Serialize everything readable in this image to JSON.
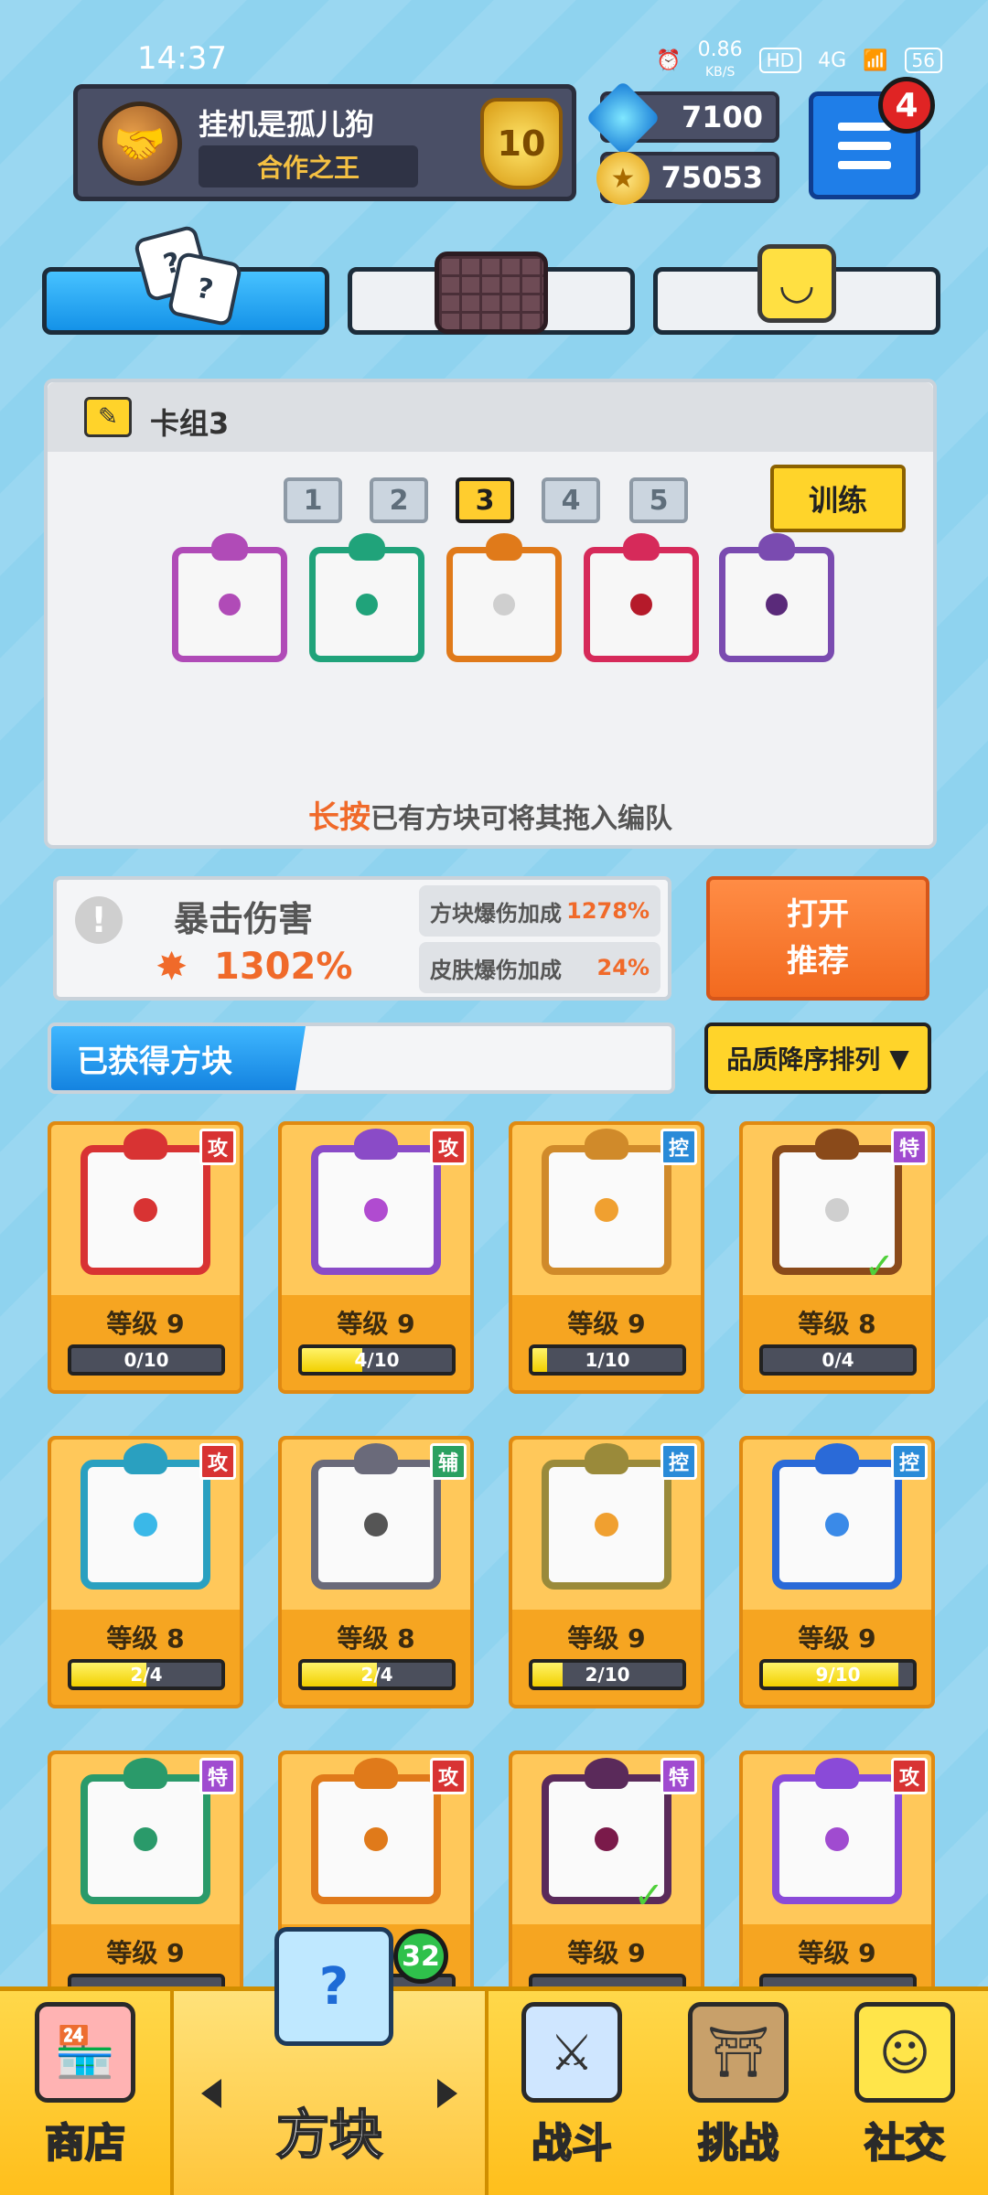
{
  "status_bar": {
    "time": "14:37",
    "net_speed": "0.86",
    "net_unit": "KB/S",
    "hd": "HD",
    "network": "4G",
    "battery": "56"
  },
  "profile": {
    "name": "挂机是孤儿狗",
    "title": "合作之王",
    "rank": "10"
  },
  "currency": {
    "gems": "7100",
    "coins": "75053"
  },
  "menu": {
    "badge": "4"
  },
  "deck": {
    "title": "卡组3",
    "numbers": [
      "1",
      "2",
      "3",
      "4",
      "5"
    ],
    "active_index": 2,
    "train_label": "训练",
    "slots": [
      {
        "border": "#b04bb7",
        "dot": "#b04bb7"
      },
      {
        "border": "#20a37a",
        "dot": "#20a37a"
      },
      {
        "border": "#e07a1a",
        "dot": "#cfcfcf"
      },
      {
        "border": "#d62a5a",
        "dot": "#b51a2a"
      },
      {
        "border": "#7a4bb0",
        "dot": "#5a2a7a"
      }
    ],
    "hint_highlight": "长按",
    "hint_text": "已有方块可将其拖入编队"
  },
  "crit": {
    "title": "暴击伤害",
    "value": "1302%",
    "stats": [
      {
        "label": "方块爆伤加成",
        "value": "1278%"
      },
      {
        "label": "皮肤爆伤加成",
        "value": "24%"
      }
    ]
  },
  "recommend": {
    "line1": "打开",
    "line2": "推荐"
  },
  "obtained": {
    "label": "已获得方块",
    "sort_label": "品质降序排列",
    "sort_icon": "▼"
  },
  "cards": [
    {
      "tag": "攻",
      "tag_color": "#d83333",
      "border": "#d83333",
      "dot": "#d83333",
      "level": "等级 9",
      "progress": "0/10",
      "fill": 0,
      "check": false
    },
    {
      "tag": "攻",
      "tag_color": "#d83333",
      "border": "#8a4bc7",
      "dot": "#b04bd0",
      "level": "等级 9",
      "progress": "4/10",
      "fill": 0.4,
      "check": false
    },
    {
      "tag": "控",
      "tag_color": "#2a8bd8",
      "border": "#d08a2a",
      "dot": "#f0a030",
      "level": "等级 9",
      "progress": "1/10",
      "fill": 0.1,
      "check": false
    },
    {
      "tag": "特",
      "tag_color": "#a04bd0",
      "border": "#8a4a1a",
      "dot": "#cfcfcf",
      "level": "等级 8",
      "progress": "0/4",
      "fill": 0,
      "check": true
    },
    {
      "tag": "攻",
      "tag_color": "#d83333",
      "border": "#2aa0c0",
      "dot": "#3ab8e8",
      "level": "等级 8",
      "progress": "2/4",
      "fill": 0.5,
      "check": false
    },
    {
      "tag": "辅",
      "tag_color": "#2aa060",
      "border": "#6a6a7a",
      "dot": "#555",
      "level": "等级 8",
      "progress": "2/4",
      "fill": 0.5,
      "check": false
    },
    {
      "tag": "控",
      "tag_color": "#2a8bd8",
      "border": "#9a8a3a",
      "dot": "#f0a030",
      "level": "等级 9",
      "progress": "2/10",
      "fill": 0.2,
      "check": false
    },
    {
      "tag": "控",
      "tag_color": "#2a8bd8",
      "border": "#2a6ad8",
      "dot": "#3a8ae8",
      "level": "等级 9",
      "progress": "9/10",
      "fill": 0.9,
      "check": false
    },
    {
      "tag": "特",
      "tag_color": "#a04bd0",
      "border": "#2a9a6a",
      "dot": "#2a9a6a",
      "level": "等级 9",
      "progress": "",
      "fill": 0,
      "check": false
    },
    {
      "tag": "攻",
      "tag_color": "#d83333",
      "border": "#e07a1a",
      "dot": "#e07a1a",
      "level": "",
      "progress": "",
      "fill": 0,
      "check": false
    },
    {
      "tag": "特",
      "tag_color": "#a04bd0",
      "border": "#5a2a5a",
      "dot": "#7a1a4a",
      "level": "等级 9",
      "progress": "",
      "fill": 0,
      "check": true
    },
    {
      "tag": "攻",
      "tag_color": "#d83333",
      "border": "#8a4ad8",
      "dot": "#a04bd0",
      "level": "等级 9",
      "progress": "",
      "fill": 0,
      "check": false
    }
  ],
  "bottom_nav": {
    "shop": "商店",
    "blocks": "方块",
    "blocks_badge": "32",
    "battle": "战斗",
    "challenge": "挑战",
    "social": "社交"
  }
}
